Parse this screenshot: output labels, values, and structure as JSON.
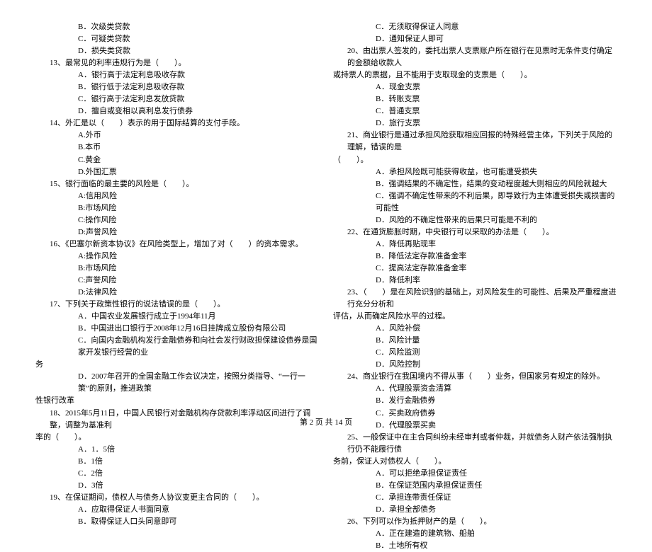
{
  "footer": "第 2 页 共 14 页",
  "left": [
    {
      "cls": "indent1",
      "t": "B．次级类贷款"
    },
    {
      "cls": "indent1",
      "t": "C．可疑类贷款"
    },
    {
      "cls": "indent1",
      "t": "D．损失类贷款"
    },
    {
      "cls": "indent0",
      "t": "13、最常见的利率违规行为是（　　）。"
    },
    {
      "cls": "indent1",
      "t": "A．银行高于法定利息吸收存款"
    },
    {
      "cls": "indent1",
      "t": "B．银行低于法定利息吸收存款"
    },
    {
      "cls": "indent1",
      "t": "C．银行高于法定利息发放贷款"
    },
    {
      "cls": "indent1",
      "t": "D．擅自或变相以高利息发行债券"
    },
    {
      "cls": "indent0",
      "t": "14、外汇是以（　　）表示的用于国际结算的支付手段。"
    },
    {
      "cls": "indent1",
      "t": "A.外币"
    },
    {
      "cls": "indent1",
      "t": "B.本币"
    },
    {
      "cls": "indent1",
      "t": "C.黄金"
    },
    {
      "cls": "indent1",
      "t": "D.外国汇票"
    },
    {
      "cls": "indent0",
      "t": "15、银行面临的最主要的风险是（　　）。"
    },
    {
      "cls": "indent1",
      "t": "A:信用风险"
    },
    {
      "cls": "indent1",
      "t": "B:市场风险"
    },
    {
      "cls": "indent1",
      "t": "C:操作风险"
    },
    {
      "cls": "indent1",
      "t": "D:声誉风险"
    },
    {
      "cls": "indent0",
      "t": "16、《巴塞尔新资本协议》在风险类型上，增加了对（　　）的资本需求。"
    },
    {
      "cls": "indent1",
      "t": "A:操作风险"
    },
    {
      "cls": "indent1",
      "t": "B:市场风险"
    },
    {
      "cls": "indent1",
      "t": "C:声誉风险"
    },
    {
      "cls": "indent1",
      "t": "D:法律风险"
    },
    {
      "cls": "indent0",
      "t": "17、下列关于政策性银行的说法错误的是（　　）。"
    },
    {
      "cls": "indent1",
      "t": "A．中国农业发展银行成立于1994年11月"
    },
    {
      "cls": "indent1",
      "t": "B．中国进出口银行于2008年12月16日挂牌成立股份有限公司"
    },
    {
      "cls": "indent1",
      "t": "C．向国内金融机构发行金融债券和向社会发行财政担保建设债券是国家开发银行经营的业"
    },
    {
      "cls": "noindent",
      "t": "务"
    },
    {
      "cls": "indent1",
      "t": "D．2007年召开的全国金融工作会议决定，按照分类指导、“一行一策”的原则，推进政策"
    },
    {
      "cls": "noindent",
      "t": "性银行改革"
    },
    {
      "cls": "indent0",
      "t": "18、2015年5月11日，中国人民银行对金融机构存贷款利率浮动区间进行了调整，调整为基准利"
    },
    {
      "cls": "noindent",
      "t": "率的（　　）。"
    },
    {
      "cls": "indent1",
      "t": "A．1．5倍"
    },
    {
      "cls": "indent1",
      "t": "B．1倍"
    },
    {
      "cls": "indent1",
      "t": "C．2倍"
    },
    {
      "cls": "indent1",
      "t": "D．3倍"
    },
    {
      "cls": "indent0",
      "t": "19、在保证期间，债权人与债务人协议变更主合同的（　　）。"
    },
    {
      "cls": "indent1",
      "t": "A．应取得保证人书面同意"
    },
    {
      "cls": "indent1",
      "t": "B．取得保证人口头同意即可"
    }
  ],
  "right": [
    {
      "cls": "indent1",
      "t": "C．无须取得保证人同意"
    },
    {
      "cls": "indent1",
      "t": "D．通知保证人即可"
    },
    {
      "cls": "indent0",
      "t": "20、由出票人签发的，委托出票人支票账户所在银行在见票时无条件支付确定的金额给收款人"
    },
    {
      "cls": "noindent",
      "t": "或持票人的票据，且不能用于支取现金的支票是（　　）。"
    },
    {
      "cls": "indent1",
      "t": "A．现金支票"
    },
    {
      "cls": "indent1",
      "t": "B．转账支票"
    },
    {
      "cls": "indent1",
      "t": "C．普通支票"
    },
    {
      "cls": "indent1",
      "t": "D．旅行支票"
    },
    {
      "cls": "indent0",
      "t": "21、商业银行是通过承担风险获取相应回报的特殊经营主体，下列关于风险的理解，错误的是"
    },
    {
      "cls": "noindent",
      "t": "（　　）。"
    },
    {
      "cls": "indent1",
      "t": "A．承担风险既可能获得收益，也可能遭受损失"
    },
    {
      "cls": "indent1",
      "t": "B．强调结果的不确定性，结果的变动程度越大则相应的风险就越大"
    },
    {
      "cls": "indent1",
      "t": "C．强调不确定性带来的不利后果，即导致行为主体遭受损失或损害的可能性"
    },
    {
      "cls": "indent1",
      "t": "D．风险的不确定性带来的后果只可能是不利的"
    },
    {
      "cls": "indent0",
      "t": "22、在通货膨胀时期，中央银行可以采取的办法是（　　）。"
    },
    {
      "cls": "indent1",
      "t": "A．降低再贴现率"
    },
    {
      "cls": "indent1",
      "t": "B．降低法定存款准备金率"
    },
    {
      "cls": "indent1",
      "t": "C．提高法定存款准备金率"
    },
    {
      "cls": "indent1",
      "t": "D．降低利率"
    },
    {
      "cls": "indent0",
      "t": "23、（　　）是在风险识别的基础上，对风险发生的可能性、后果及严重程度进行充分分析和"
    },
    {
      "cls": "noindent",
      "t": "评估，从而确定风险水平的过程。"
    },
    {
      "cls": "indent1",
      "t": "A．风险补偿"
    },
    {
      "cls": "indent1",
      "t": "B．风险计量"
    },
    {
      "cls": "indent1",
      "t": "C．风险监测"
    },
    {
      "cls": "indent1",
      "t": "D．风险控制"
    },
    {
      "cls": "indent0",
      "t": "24、商业银行在我国境内不得从事（　　）业务，但国家另有规定的除外。"
    },
    {
      "cls": "indent1",
      "t": "A．代理股票资金清算"
    },
    {
      "cls": "indent1",
      "t": "B．发行金融债券"
    },
    {
      "cls": "indent1",
      "t": "C．买卖政府债券"
    },
    {
      "cls": "indent1",
      "t": "D．代理股票买卖"
    },
    {
      "cls": "indent0",
      "t": "25、一般保证中在主合同纠纷未经审判或者仲裁，并就债务人财产依法强制执行仍不能履行债"
    },
    {
      "cls": "noindent",
      "t": "务前，保证人对债权人（　　）。"
    },
    {
      "cls": "indent1",
      "t": "A．可以拒绝承担保证责任"
    },
    {
      "cls": "indent1",
      "t": "B．在保证范围内承担保证责任"
    },
    {
      "cls": "indent1",
      "t": "C．承担连带责任保证"
    },
    {
      "cls": "indent1",
      "t": "D．承担全部债务"
    },
    {
      "cls": "indent0",
      "t": "26、下列可以作为抵押财产的是（　　）。"
    },
    {
      "cls": "indent1",
      "t": "A．正在建造的建筑物、船舶"
    },
    {
      "cls": "indent1",
      "t": "B．土地所有权"
    }
  ]
}
